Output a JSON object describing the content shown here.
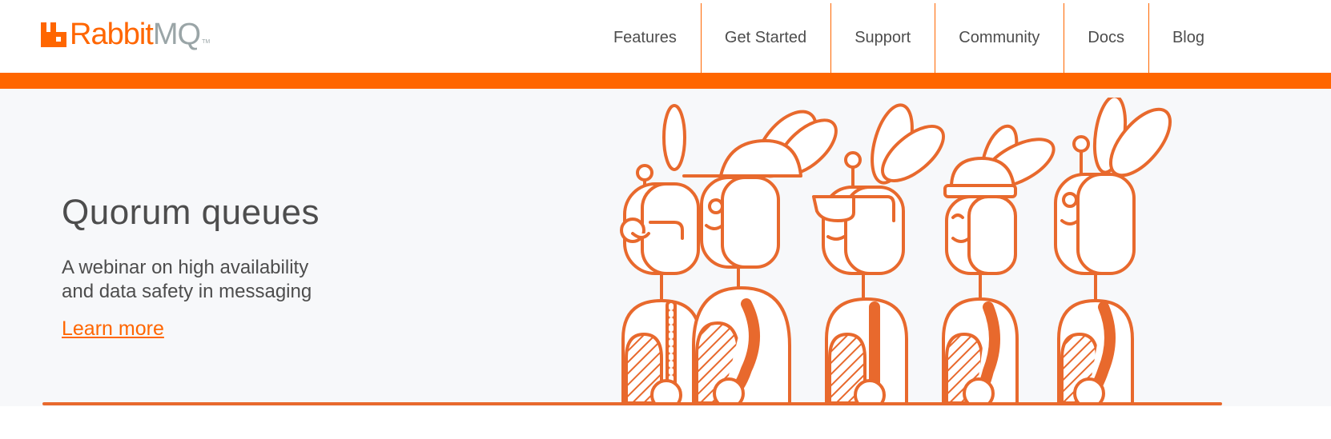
{
  "brand": {
    "name_primary": "Rabbit",
    "name_secondary": "MQ",
    "trademark": "TM",
    "accent_color": "#ff6600",
    "muted_color": "#9aa5a7"
  },
  "nav": {
    "items": [
      {
        "label": "Features"
      },
      {
        "label": "Get Started"
      },
      {
        "label": "Support"
      },
      {
        "label": "Community"
      },
      {
        "label": "Docs"
      },
      {
        "label": "Blog"
      }
    ]
  },
  "hero": {
    "title": "Quorum queues",
    "subtitle_line1": "A webinar on high availability",
    "subtitle_line2": "and data safety in messaging",
    "link_label": "Learn more",
    "illustration_icon": "robot-rabbits-illustration"
  }
}
